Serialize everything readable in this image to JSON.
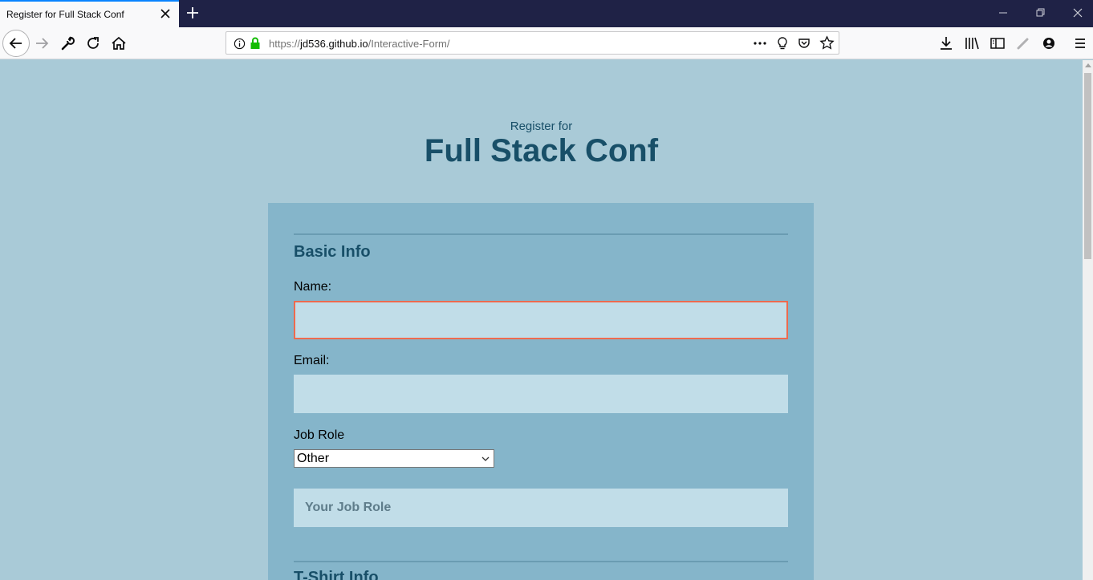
{
  "browser": {
    "tab_title": "Register for Full Stack Conf",
    "url_prefix": "https://",
    "url_domain": "jd536.github.io",
    "url_path": "/Interactive-Form/"
  },
  "page": {
    "subtitle": "Register for",
    "title": "Full Stack Conf"
  },
  "form": {
    "basic_info_legend": "Basic Info",
    "name_label": "Name:",
    "name_value": "",
    "email_label": "Email:",
    "email_value": "",
    "job_role_label": "Job Role",
    "job_role_selected": "Other",
    "other_role_placeholder": "Your Job Role",
    "tshirt_legend": "T-Shirt Info"
  },
  "colors": {
    "page_bg": "#a9cad7",
    "form_bg": "#85b5ca",
    "heading": "#184f68",
    "input_bg": "#c1dde8",
    "error_border": "#ee6a4e"
  }
}
